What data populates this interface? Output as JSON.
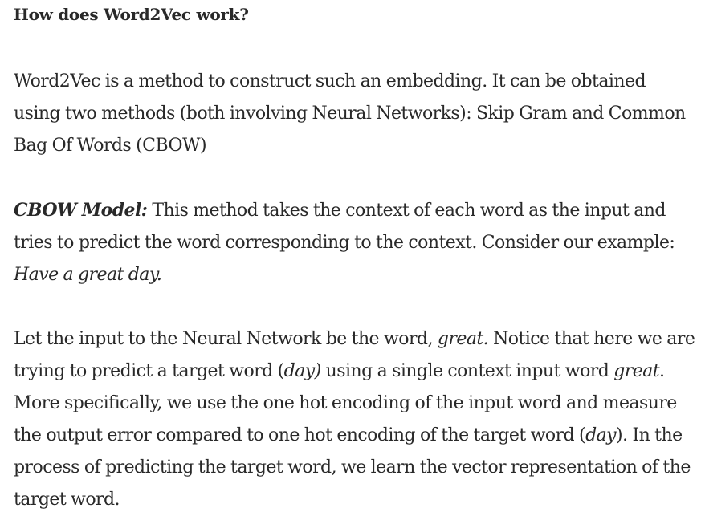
{
  "heading": "How does Word2Vec work?",
  "p1": {
    "text": "Word2Vec is a method to construct such an embedding. It can be obtained using two methods (both involving Neural Networks): Skip Gram and Common Bag Of Words (CBOW)"
  },
  "p2": {
    "label": "CBOW Model:",
    "text_a": " This method takes the context of each word as the input and tries to predict the word corresponding to the context. Consider our example: ",
    "example": "Have a great day."
  },
  "p3": {
    "t1": "Let the input to the Neural Network be the word, ",
    "w1": "great.",
    "t2": " Notice that here we are trying to predict a target word (",
    "w2": "day)",
    "t3": " using a single context input word ",
    "w3": "great",
    "t4": ". More specifically, we use the one hot encoding of the input word and measure the output error compared to one hot encoding of the target word (",
    "w4": "day",
    "t5": "). In the process of predicting the target word, we learn the vector representation of the target word."
  }
}
